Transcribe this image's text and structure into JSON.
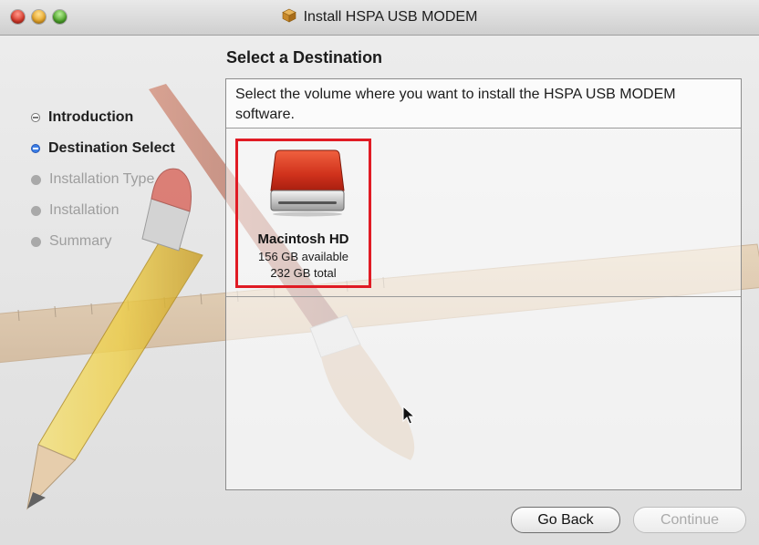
{
  "window": {
    "title": "Install HSPA USB MODEM"
  },
  "sidebar": {
    "steps": [
      {
        "label": "Introduction",
        "state": "done"
      },
      {
        "label": "Destination Select",
        "state": "current"
      },
      {
        "label": "Installation Type",
        "state": "pending"
      },
      {
        "label": "Installation",
        "state": "pending"
      },
      {
        "label": "Summary",
        "state": "pending"
      }
    ]
  },
  "main": {
    "heading": "Select a Destination",
    "instructions": "Select the volume where you want to install the HSPA USB MODEM software.",
    "volume": {
      "name": "Macintosh HD",
      "available": "156 GB available",
      "total": "232 GB total"
    }
  },
  "buttons": {
    "go_back": "Go Back",
    "continue": "Continue"
  },
  "colors": {
    "selection": "#e01b24",
    "drive": "#d0321c",
    "step_current": "#3d7fe6"
  },
  "icons": [
    "package-icon",
    "hard-drive-icon",
    "pointer-icon"
  ]
}
